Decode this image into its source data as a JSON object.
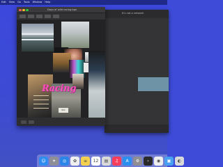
{
  "menubar": {
    "items": [
      "Edit",
      "View",
      "Go",
      "Tools",
      "Window",
      "Help"
    ]
  },
  "back_window": {
    "title": "It's not a network"
  },
  "front_window": {
    "title": "Days of wild racing.bpx",
    "toolbar_buttons": [
      "",
      "",
      "",
      "",
      ""
    ],
    "collage_text": "Racing",
    "tag_text": "RAC"
  },
  "dock": {
    "icons": [
      {
        "name": "finder-icon",
        "color": "#2f8cf0",
        "glyph": "☺"
      },
      {
        "name": "launchpad-icon",
        "color": "#8f8f98",
        "glyph": "✦"
      },
      {
        "name": "safari-icon",
        "color": "#2b86e8",
        "glyph": "◎"
      },
      {
        "name": "photos-icon",
        "color": "#eeeeee",
        "glyph": "✿"
      },
      {
        "name": "notes-icon",
        "color": "#f4d24f",
        "glyph": "≡"
      },
      {
        "name": "calendar-icon",
        "color": "#ffffff",
        "glyph": "12"
      },
      {
        "name": "files-icon",
        "color": "#d9d9d9",
        "glyph": "▤"
      },
      {
        "name": "music-icon",
        "color": "#fa3e5c",
        "glyph": "♫"
      },
      {
        "name": "app-store-icon",
        "color": "#2b8ff0",
        "glyph": "A"
      },
      {
        "name": "settings-icon",
        "color": "#8e8e93",
        "glyph": "⚙"
      },
      {
        "name": "terminal-icon",
        "color": "#2a2a2a",
        "glyph": "›"
      },
      {
        "name": "chrome-icon",
        "color": "#eeeeee",
        "glyph": "◉"
      },
      {
        "name": "preview-icon",
        "color": "#4aa0f0",
        "glyph": "▣"
      },
      {
        "name": "viewer-icon",
        "color": "#d9d9dc",
        "glyph": "◐"
      }
    ]
  }
}
